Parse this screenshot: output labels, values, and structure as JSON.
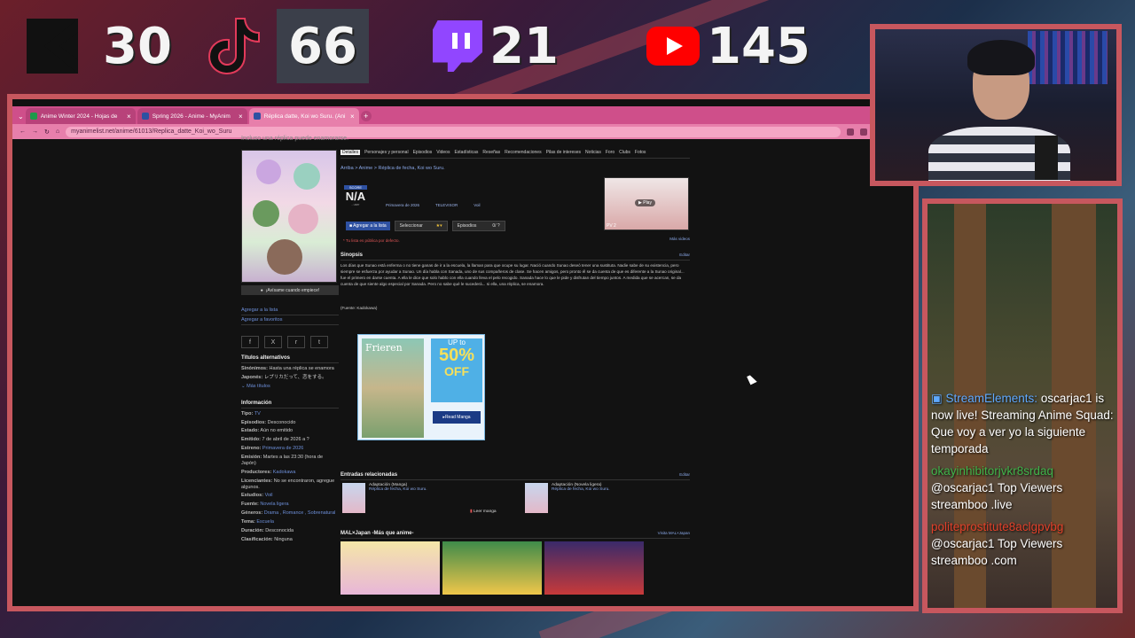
{
  "overlay": {
    "kick_count": "30",
    "tiktok_count": "66",
    "twitch_count": "21",
    "youtube_count": "145"
  },
  "browser": {
    "tabs": [
      {
        "label": "Anime Winter 2024 - Hojas de",
        "favicon_color": "#1e9a4a"
      },
      {
        "label": "Spring 2026 - Anime - MyAnim",
        "favicon_color": "#2e51a2"
      },
      {
        "label": "Réplica datte, Koi wo Suru. (Ani",
        "favicon_color": "#2e51a2"
      }
    ],
    "url": "myanimelist.net/anime/61013/Replica_datte_Koi_wo_Suru"
  },
  "page": {
    "tagline": "Incluso una réplica puede enamorarse.",
    "subnav": [
      "Detalles",
      "Personajes y personal",
      "Episodios",
      "Videos",
      "Estadísticas",
      "Reseñas",
      "Recomendaciones",
      "Pilas de intereses",
      "Noticias",
      "Foro",
      "Clubs",
      "Fotos"
    ],
    "breadcrumb": "Arriba  >  Anime  >  Réplica de fecha, Koi wo Suru.",
    "score_label": "SCORE",
    "score_value": "N/A",
    "score_users": "- user",
    "season": "Primavera de 2026",
    "type": "TELEVISOR",
    "studio": "Voil",
    "add_list": "Agregar a la lista",
    "select_label": "Seleccionar",
    "episodes_label": "Episodios",
    "episodes_value": "0/ ?",
    "public_note": "* Tu lista es pública por defecto.",
    "video_label": "PV 2",
    "play_label": "Play",
    "more_videos": "Más videos",
    "synopsis_title": "Sinopsis",
    "edit_label": "Editar",
    "synopsis": "Los días que Sunao está enferma o no tiene ganas de ir a la escuela, la llaman para que ocupe su lugar. Nació cuando Sunao deseó tener una sustituta. Nadie sabe de su existencia, pero siempre se esfuerza por ayudar a Sunao. Un día habla con Sanada, uno de sus compañeros de clase. Se hacen amigos, pero pronto él se da cuenta de que es diferente a la Sunao original... fue el primero en darse cuenta. A ella le dice que solo hablo con ella cuando lleva el pelo recogido. Sanada hace lo que le pide y disfrutan del tiempo juntos. A medida que se acercan, se da cuenta de que siente algo especial por Sanada. Pero no sabe qué le sucederá... si ella, una réplica, se enamora.",
    "source": "(Fuente: Kadokawa)",
    "ad": {
      "title": "Frieren",
      "up": "UP to",
      "percent": "50%",
      "off": "OFF",
      "cta": "Read Manga"
    },
    "related_title": "Entradas relacionadas",
    "related": [
      {
        "type": "Adaptación (Manga)",
        "title": "Réplica de fecha, Koi wo Suru."
      },
      {
        "type": "Adaptación (Novela ligera)",
        "title": "Réplica de fecha, Koi wo Suru."
      }
    ],
    "read_manga": "Leer manga",
    "malx_title": "MAL×Japan -Más que anime-",
    "malx_link": "Visita MAL×Japan",
    "left": {
      "notify": "¡Avísame cuando empiece!",
      "add_list": "Agregar a la lista",
      "add_fav": "Agregar a favoritos",
      "share_icons": [
        "f",
        "X",
        "r",
        "t"
      ],
      "alt_titles_h": "Títulos alternativos",
      "synonyms_label": "Sinónimos:",
      "synonyms_value": "Hasta una réplica se enamora",
      "japanese_label": "Japonés:",
      "japanese_value": "レプリカだって、恋をする。",
      "more_titles": "Más títulos",
      "info_h": "Información",
      "info": [
        {
          "k": "Tipo:",
          "v": "TV"
        },
        {
          "k": "Episodios:",
          "v": "Desconocido"
        },
        {
          "k": "Estado:",
          "v": "Aún no emitido"
        },
        {
          "k": "Emitido:",
          "v": "7 de abril de 2026 a ?"
        },
        {
          "k": "Estreno:",
          "v": "Primavera de 2026"
        },
        {
          "k": "Emisión:",
          "v": "Martes a las 23:30 (hora de Japón)"
        },
        {
          "k": "Productores:",
          "v": "Kadokawa"
        },
        {
          "k": "Licenciantes:",
          "v": "No se encontraron, agregue algunos."
        },
        {
          "k": "Estudios:",
          "v": "Voil"
        },
        {
          "k": "Fuente:",
          "v": "Novela ligera"
        },
        {
          "k": "Géneros:",
          "v": "Drama , Romance , Sobrenatural"
        },
        {
          "k": "Tema:",
          "v": "Escuela"
        },
        {
          "k": "Duración:",
          "v": "Desconocida"
        },
        {
          "k": "Clasificación:",
          "v": "Ninguna"
        }
      ]
    }
  },
  "chat": {
    "lines": [
      {
        "user": "StreamElements:",
        "cls": "se",
        "text": " oscarjac1 is now live! Streaming Anime Squad: Que voy a ver yo la siguiente temporada"
      },
      {
        "user": "okayinhibitorjvkr8srdaq",
        "cls": "u1",
        "text": " @oscarjac1 Top Viewers streamboo .live"
      },
      {
        "user": "politeprostitute8aclgpvbg",
        "cls": "u2",
        "text": " @oscarjac1 Top Viewers streamboo .com"
      }
    ]
  }
}
